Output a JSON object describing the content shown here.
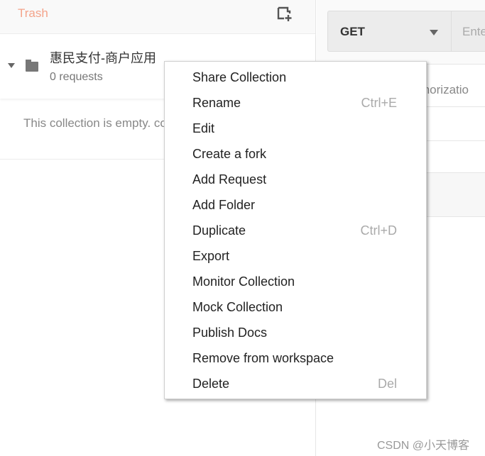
{
  "sidebar": {
    "trash_label": "Trash",
    "collection": {
      "name": "惠民支付-商户应用",
      "requests": "0 requests"
    },
    "empty_text": "This collection is empty. collection and create fol"
  },
  "request": {
    "method": "GET",
    "url_placeholder": "Ente",
    "tab_partial": "thorizatio"
  },
  "context_menu": {
    "items": [
      {
        "label": "Share Collection",
        "shortcut": ""
      },
      {
        "label": "Rename",
        "shortcut": "Ctrl+E"
      },
      {
        "label": "Edit",
        "shortcut": ""
      },
      {
        "label": "Create a fork",
        "shortcut": ""
      },
      {
        "label": "Add Request",
        "shortcut": ""
      },
      {
        "label": "Add Folder",
        "shortcut": ""
      },
      {
        "label": "Duplicate",
        "shortcut": "Ctrl+D"
      },
      {
        "label": "Export",
        "shortcut": ""
      },
      {
        "label": "Monitor Collection",
        "shortcut": ""
      },
      {
        "label": "Mock Collection",
        "shortcut": ""
      },
      {
        "label": "Publish Docs",
        "shortcut": ""
      },
      {
        "label": "Remove from workspace",
        "shortcut": ""
      },
      {
        "label": "Delete",
        "shortcut": "Del"
      }
    ]
  },
  "watermark": "CSDN @小天博客",
  "colors": {
    "trash": "#f4a38a"
  }
}
